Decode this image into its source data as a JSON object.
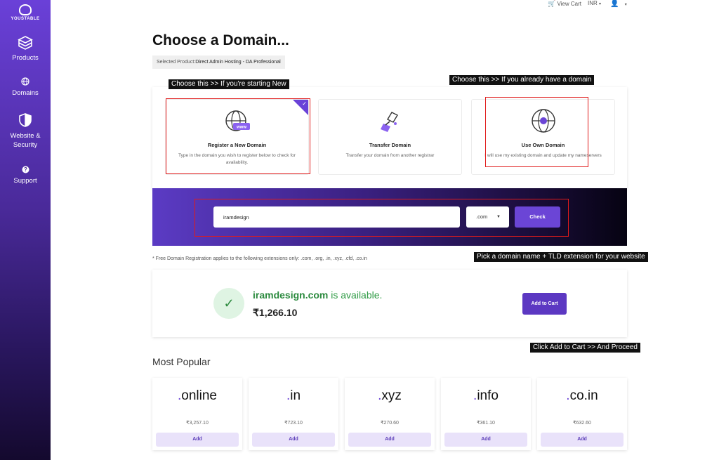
{
  "sidebar": {
    "logo_text": "YOUSTABLE",
    "items": [
      {
        "label": "Products",
        "icon": "box-icon"
      },
      {
        "label": "Domains",
        "icon": "globe-icon"
      },
      {
        "label": "Website & Security",
        "icon": "shield-icon"
      },
      {
        "label": "Support",
        "icon": "help-icon"
      }
    ]
  },
  "topbar": {
    "view_cart": "View Cart",
    "currency": "INR"
  },
  "page": {
    "title": "Choose a Domain...",
    "selected_product_label": "Selected Product:",
    "selected_product_value": "Direct Admin Hosting - DA Professional"
  },
  "options": [
    {
      "title": "Register a New Domain",
      "desc": "Type in the domain you wish to register below to check for availability."
    },
    {
      "title": "Transfer Domain",
      "desc": "Transfer your domain from another registrar"
    },
    {
      "title": "Use Own Domain",
      "desc": "I will use my existing domain and update my nameservers"
    }
  ],
  "search": {
    "domain_value": "iramdesign",
    "tld": ".com",
    "check_label": "Check"
  },
  "free_note": "* Free Domain Registration applies to the following extensions only: .com, .org, .in, .xyz, .cfd, .co.in",
  "result": {
    "domain": "iramdesign.com",
    "status": "is available.",
    "price": "₹1,266.10",
    "add_to_cart": "Add to Cart"
  },
  "most_popular": {
    "heading": "Most Popular",
    "tlds": [
      {
        "dot": ".",
        "name": "online",
        "price": "₹3,257.10",
        "add": "Add"
      },
      {
        "dot": ".",
        "name": "in",
        "price": "₹723.10",
        "add": "Add"
      },
      {
        "dot": ".",
        "name": "xyz",
        "price": "₹270.60",
        "add": "Add"
      },
      {
        "dot": ".",
        "name": "info",
        "price": "₹361.10",
        "add": "Add"
      },
      {
        "dot": ".",
        "name": "co.in",
        "price": "₹632.60",
        "add": "Add"
      }
    ]
  },
  "annotations": {
    "new_domain": "Choose this >> If you're starting New",
    "own_domain": "Choose this >> If you already have a domain",
    "pick_domain": "Pick a domain name + TLD extension for your website",
    "add_cart": "Click Add to Cart >> And Proceed"
  },
  "colors": {
    "accent": "#6b45d6",
    "available": "#2f9b45",
    "annotation_red": "#e01b1b"
  }
}
